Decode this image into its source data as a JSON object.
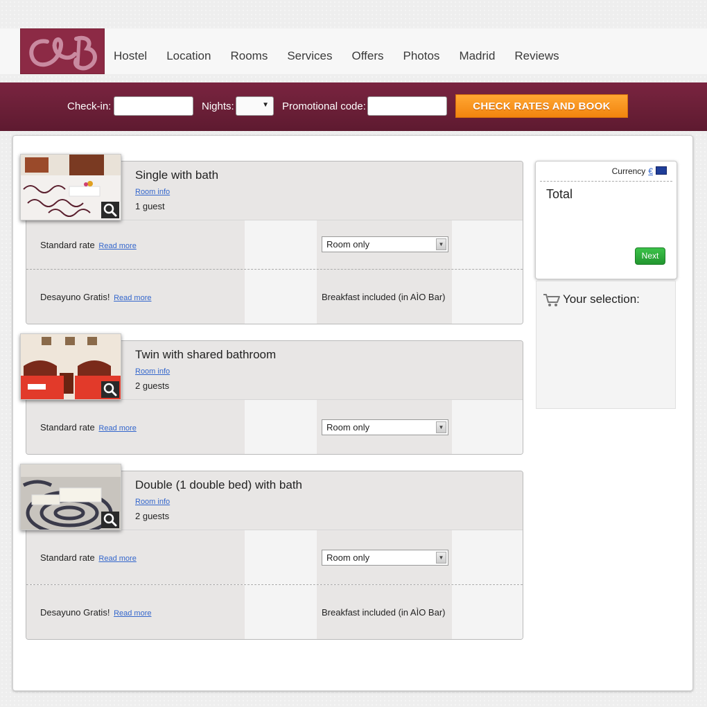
{
  "colors": {
    "brand": "#8c2a45",
    "bookbar": "#6a1f37",
    "accent": "#f2840e",
    "next": "#22962f",
    "link": "#3366cc"
  },
  "header": {
    "logo_icon": "hostel-logo-icon",
    "nav": [
      "Hostel",
      "Location",
      "Rooms",
      "Services",
      "Offers",
      "Photos",
      "Madrid",
      "Reviews"
    ]
  },
  "booking": {
    "checkin_label": "Check-in:",
    "checkin_value": "",
    "nights_label": "Nights:",
    "nights_value": "",
    "promo_label": "Promotional code:",
    "promo_value": "",
    "book_label": "CHECK RATES AND BOOK"
  },
  "rooms": [
    {
      "title": "Single with bath",
      "info": "Room info",
      "guests": "1 guest",
      "rates": [
        {
          "name": "Standard rate",
          "more": "Read more",
          "option": "Room only",
          "type": "select"
        },
        {
          "name": "Desayuno Gratis!",
          "more": "Read more",
          "option": "Breakfast included (in AÌO Bar)",
          "type": "text"
        }
      ]
    },
    {
      "title": "Twin with shared bathroom",
      "info": "Room info",
      "guests": "2 guests",
      "rates": [
        {
          "name": "Standard rate",
          "more": "Read more",
          "option": "Room only",
          "type": "select"
        }
      ]
    },
    {
      "title": "Double (1 double bed) with bath",
      "info": "Room info",
      "guests": "2 guests",
      "rates": [
        {
          "name": "Standard rate",
          "more": "Read more",
          "option": "Room only",
          "type": "select"
        },
        {
          "name": "Desayuno Gratis!",
          "more": "Read more",
          "option": "Breakfast included (in AÌO Bar)",
          "type": "text"
        }
      ]
    }
  ],
  "sidebar": {
    "currency_label": "Currency",
    "currency_symbol": "€",
    "total_label": "Total",
    "next_label": "Next",
    "selection_label": "Your selection:"
  }
}
